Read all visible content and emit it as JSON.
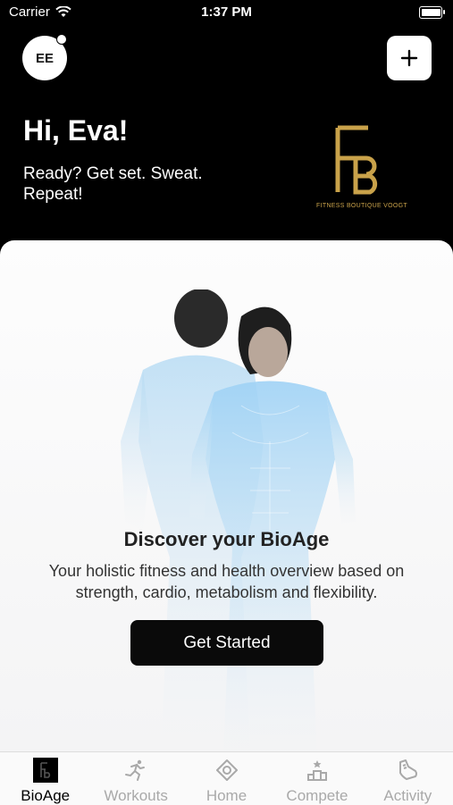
{
  "status_bar": {
    "carrier": "Carrier",
    "time": "1:37 PM"
  },
  "header": {
    "avatar_initials": "EE",
    "greeting": "Hi, Eva!",
    "tagline": "Ready? Get set. Sweat. Repeat!",
    "logo_text": "FITNESS BOUTIQUE VOOGT",
    "add_icon": "plus-icon"
  },
  "card": {
    "title": "Discover your BioAge",
    "description": "Your holistic fitness and health overview based on strength, cardio, metabolism and flexibility.",
    "cta_label": "Get Started"
  },
  "tabs": [
    {
      "label": "BioAge",
      "icon": "bioage-logo-icon",
      "active": true
    },
    {
      "label": "Workouts",
      "icon": "running-person-icon",
      "active": false
    },
    {
      "label": "Home",
      "icon": "home-target-icon",
      "active": false
    },
    {
      "label": "Compete",
      "icon": "podium-icon",
      "active": false
    },
    {
      "label": "Activity",
      "icon": "activity-shoe-icon",
      "active": false
    }
  ],
  "colors": {
    "accent_gold": "#c9a24a",
    "inactive_tab": "#a9a9a9"
  }
}
